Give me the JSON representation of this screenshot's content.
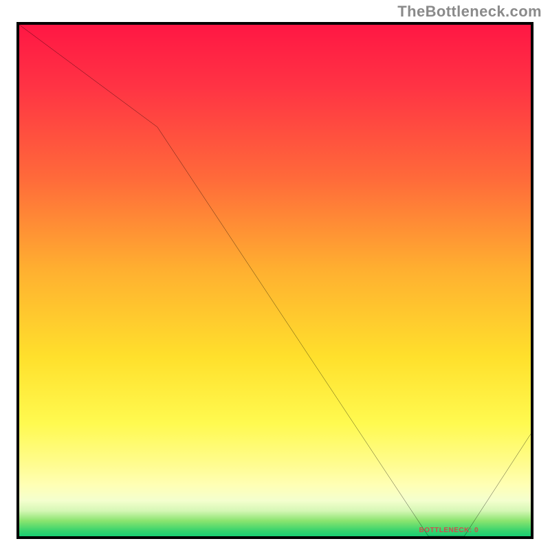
{
  "attribution": "TheBottleneck.com",
  "chart_data": {
    "type": "line",
    "title": "",
    "xlabel": "",
    "ylabel": "",
    "x": [
      0,
      27,
      80,
      87,
      100
    ],
    "values": [
      100,
      80,
      0,
      0,
      20
    ],
    "ylim": [
      0,
      100
    ],
    "xlim": [
      0,
      100
    ],
    "annotation": {
      "x": 83,
      "y": 0,
      "label": "BOTTLENECK: 0"
    }
  }
}
